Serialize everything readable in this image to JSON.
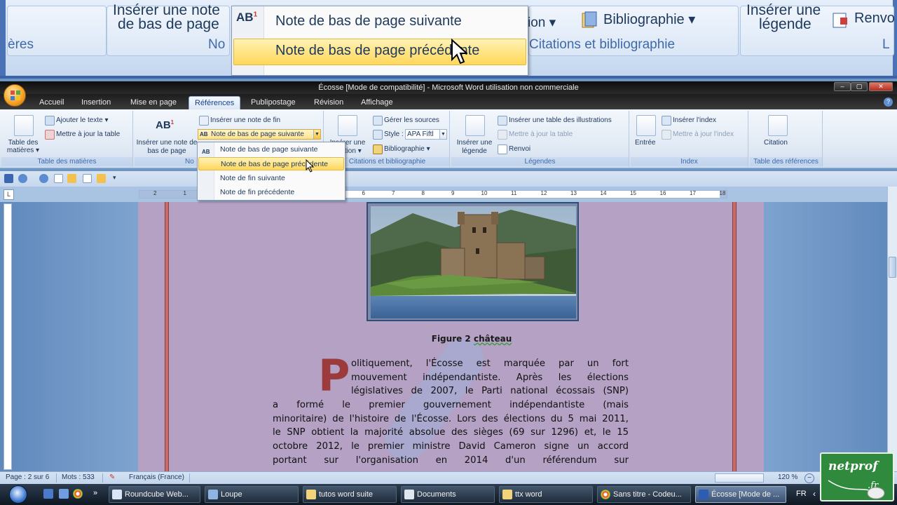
{
  "magnifier": {
    "left_group_line1": "Insérer une note",
    "left_group_line2": "de bas de page",
    "left_caption": "ères",
    "left_caption2": "No",
    "menu_item1": "Note de bas de page suivante",
    "menu_item2": "Note de bas de page précédente",
    "right_text1": "ion ▾",
    "right_biblio": "Bibliographie ▾",
    "right_caption": "Citations et bibliographie",
    "far_line1": "Insérer une",
    "far_line2": "légende",
    "far_renvoi": "Renvo",
    "far_caption": "L"
  },
  "window": {
    "title": "Écosse [Mode de compatibilité] - Microsoft Word utilisation non commerciale"
  },
  "tabs": [
    "Accueil",
    "Insertion",
    "Mise en page",
    "Références",
    "Publipostage",
    "Révision",
    "Affichage"
  ],
  "ribbon": {
    "toc_button": "Table des matières ▾",
    "toc_add_text": "Ajouter le texte ▾",
    "toc_update": "Mettre à jour la table",
    "toc_group": "Table des matières",
    "fn_insert": "Insérer une note de bas de page",
    "fn_endnote": "Insérer une note de fin",
    "fn_next_combo": "Note de bas de page suivante",
    "fn_group": "No",
    "cit_insert": "Insérer une citation ▾",
    "cit_manage": "Gérer les sources",
    "cit_style_label": "Style :",
    "cit_style_value": "APA Fiftl",
    "cit_biblio": "Bibliographie ▾",
    "cit_group": "Citations et bibliographie",
    "leg_insert": "Insérer une légende",
    "leg_table": "Insérer une table des illustrations",
    "leg_update": "Mettre à jour la table",
    "leg_renvoi": "Renvoi",
    "leg_group": "Légendes",
    "idx_entree": "Entrée",
    "idx_insert": "Insérer l'index",
    "idx_update": "Mettre à jour l'index",
    "idx_group": "Index",
    "ref_citation": "Citation",
    "ref_group": "Table des références"
  },
  "dropdown": {
    "items": [
      {
        "label": "Note de bas de page suivante"
      },
      {
        "label": "Note de bas de page précédente"
      },
      {
        "label": "Note de fin suivante"
      },
      {
        "label": "Note de fin précédente"
      }
    ]
  },
  "ruler": {
    "numbers": [
      "2",
      "1",
      "1",
      "2",
      "3",
      "4",
      "5",
      "6",
      "7",
      "8",
      "9",
      "10",
      "11",
      "12",
      "13",
      "14",
      "15",
      "16",
      "17",
      "18"
    ],
    "corner": "L"
  },
  "document": {
    "caption_prefix": "Figure 2 ",
    "caption_word": "château",
    "dropcap": "P",
    "lines": [
      "olitiquement, l'Écosse est marquée par un fort",
      "mouvement indépendantiste. Après les élections",
      "législatives de 2007, le Parti national écossais (SNP)",
      "a formé le premier gouvernement indépendantiste (mais",
      "minoritaire) de l'histoire de l'Écosse. Lors des élections du 5 mai 2011,",
      "le SNP obtient la majorité absolue des sièges (69 sur 1296) et, le 15",
      "octobre 2012, le premier ministre David Cameron signe un accord",
      "portant sur l'organisation en 2014 d'un référendum sur"
    ]
  },
  "statusbar": {
    "page": "Page : 2 sur 6",
    "words": "Mots : 533",
    "language": "Français (France)",
    "zoom": "120 %"
  },
  "taskbar": {
    "tasks": [
      {
        "label": "Roundcube Web..."
      },
      {
        "label": "Loupe"
      },
      {
        "label": "tutos word suite"
      },
      {
        "label": "Documents"
      },
      {
        "label": "ttx word"
      },
      {
        "label": "Sans titre - Codeu..."
      },
      {
        "label": "Écosse [Mode de ..."
      }
    ],
    "lang": "FR"
  },
  "logo": {
    "brand": "netprof",
    "ext": ".fr"
  },
  "colors": {
    "ribbon_text": "#1e395b",
    "page_bg": "#b4a1c4",
    "page_border": "#c96b68",
    "dropcap": "#9c3b3b",
    "highlight": "#ffd65c"
  }
}
